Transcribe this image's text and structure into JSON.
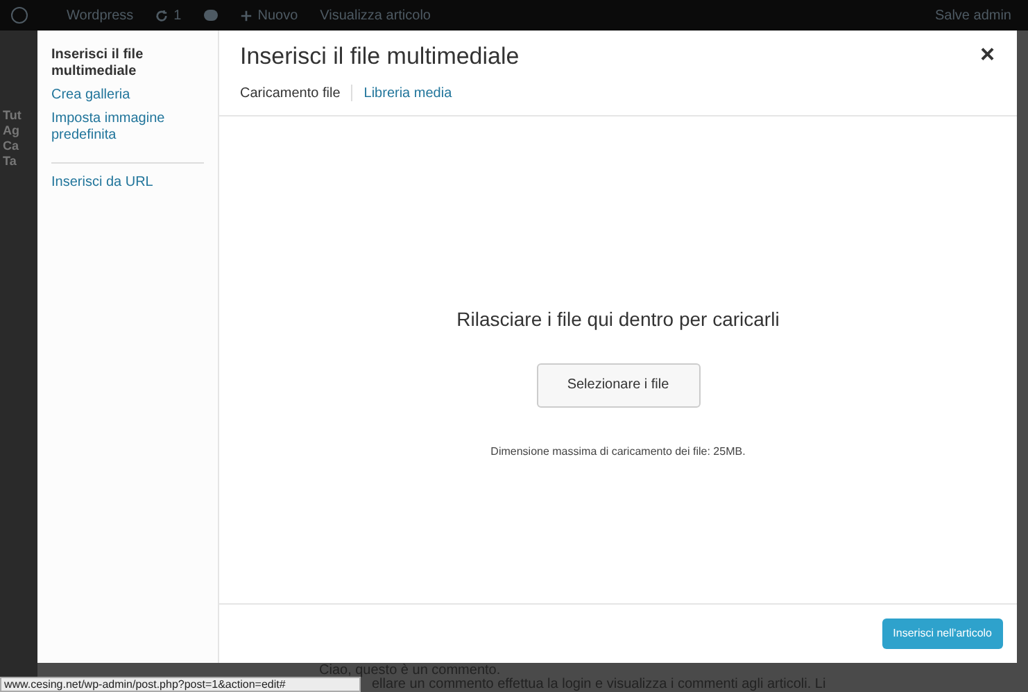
{
  "admin_bar": {
    "site": "Wordpress",
    "updates": "1",
    "new": "Nuovo",
    "view": "Visualizza articolo",
    "account": "Salve admin"
  },
  "background": {
    "menu_fragments": [
      "Tut",
      "Ag",
      "Ca",
      "Ta"
    ],
    "comment_lines": [
      "Ciao, questo è un commento.",
      "ellare un commento effettua la login e visualizza i commenti agli articoli. Li"
    ]
  },
  "modal": {
    "sidebar_groups": [
      [
        {
          "label": "Inserisci il file multimediale",
          "selected": true
        },
        {
          "label": "Crea galleria",
          "selected": false
        },
        {
          "label": "Imposta immagine predefinita",
          "selected": false
        }
      ],
      [
        {
          "label": "Inserisci da URL",
          "selected": false
        }
      ]
    ],
    "title": "Inserisci il file multimediale",
    "close": "×",
    "tabs": [
      {
        "label": "Caricamento file",
        "selected": true
      },
      {
        "label": "Libreria media",
        "selected": false
      }
    ],
    "drop_text": "Rilasciare i file qui dentro per caricarli",
    "select_button": "Selezionare i file",
    "max_size": "Dimensione massima di caricamento dei file: 25MB.",
    "insert_button": "Inserisci nell'articolo"
  },
  "status_bar": "www.cesing.net/wp-admin/post.php?post=1&action=edit#"
}
